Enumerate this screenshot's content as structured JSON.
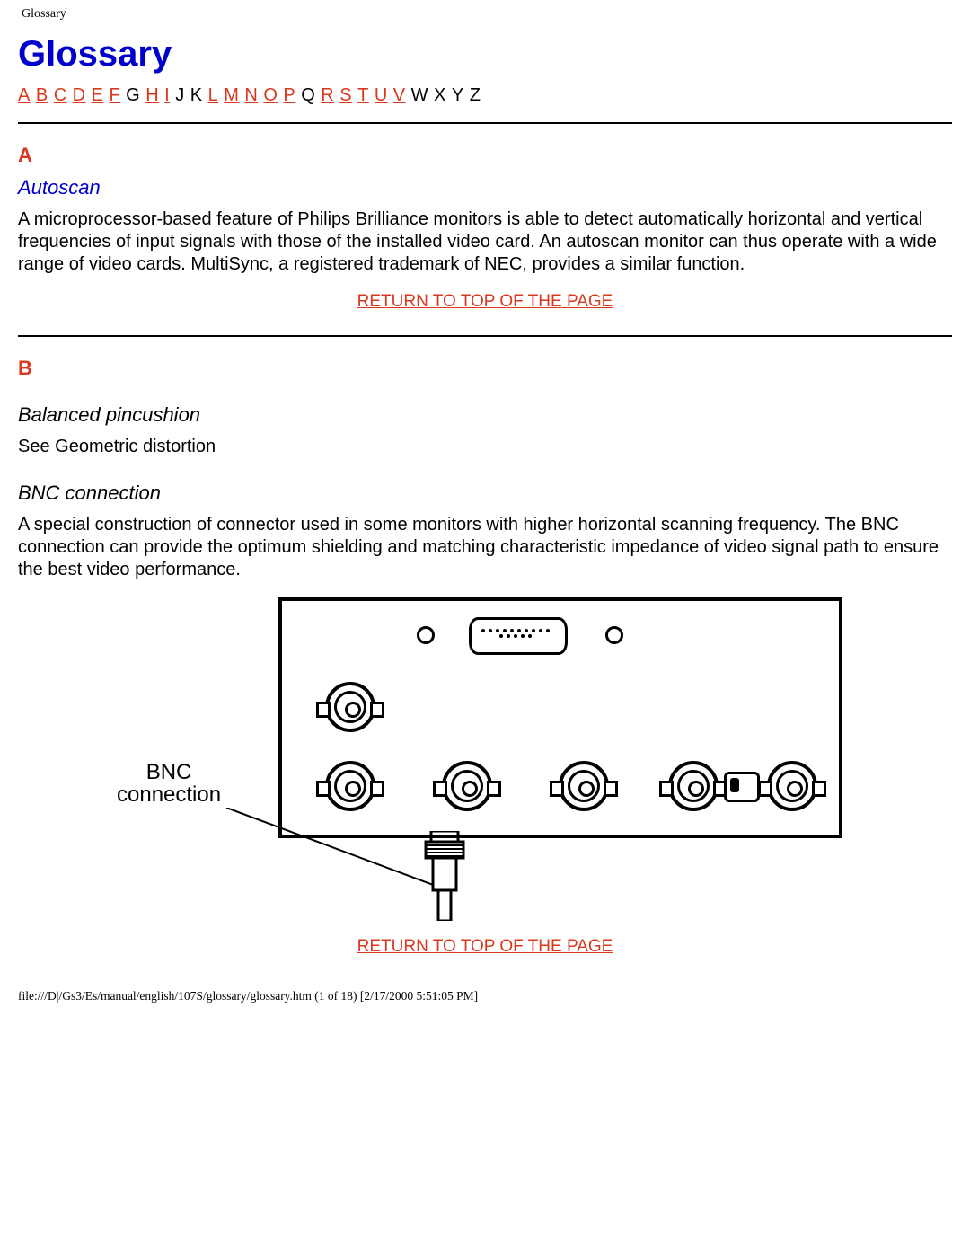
{
  "header_path": "Glossary",
  "title": "Glossary",
  "alpha_nav": [
    {
      "label": "A",
      "linked": true
    },
    {
      "label": "B",
      "linked": true
    },
    {
      "label": "C",
      "linked": true
    },
    {
      "label": "D",
      "linked": true
    },
    {
      "label": "E",
      "linked": true
    },
    {
      "label": "F",
      "linked": true
    },
    {
      "label": "G",
      "linked": false
    },
    {
      "label": "H",
      "linked": true
    },
    {
      "label": "I",
      "linked": true
    },
    {
      "label": "J",
      "linked": false
    },
    {
      "label": "K",
      "linked": false
    },
    {
      "label": "L",
      "linked": true
    },
    {
      "label": "M",
      "linked": true
    },
    {
      "label": "N",
      "linked": true
    },
    {
      "label": "O",
      "linked": true
    },
    {
      "label": "P",
      "linked": true
    },
    {
      "label": "Q",
      "linked": false
    },
    {
      "label": "R",
      "linked": true
    },
    {
      "label": "S",
      "linked": true
    },
    {
      "label": "T",
      "linked": true
    },
    {
      "label": "U",
      "linked": true
    },
    {
      "label": "V",
      "linked": true
    },
    {
      "label": "W",
      "linked": false
    },
    {
      "label": "X",
      "linked": false
    },
    {
      "label": "Y",
      "linked": false
    },
    {
      "label": "Z",
      "linked": false
    }
  ],
  "section_a": {
    "letter": "A",
    "term": "Autoscan",
    "body": "A microprocessor-based feature of Philips Brilliance monitors is able to detect automatically horizontal and vertical frequencies of input signals with those of the installed video card. An autoscan monitor can thus operate with a wide range of video cards. MultiSync, a registered trademark of NEC, provides a similar function."
  },
  "return_link": "RETURN TO TOP OF THE PAGE",
  "section_b": {
    "letter": "B",
    "term1": "Balanced pincushion",
    "body1": "See Geometric distortion",
    "term2": "BNC connection",
    "body2": "A special construction of connector used in some monitors with higher horizontal scanning frequency. The BNC connection can provide the optimum shielding and matching characteristic impedance of video signal path to ensure the best video performance."
  },
  "figure": {
    "label_line1": "BNC",
    "label_line2": "connection"
  },
  "footer": "file:///D|/Gs3/Es/manual/english/107S/glossary/glossary.htm (1 of 18) [2/17/2000 5:51:05 PM]"
}
